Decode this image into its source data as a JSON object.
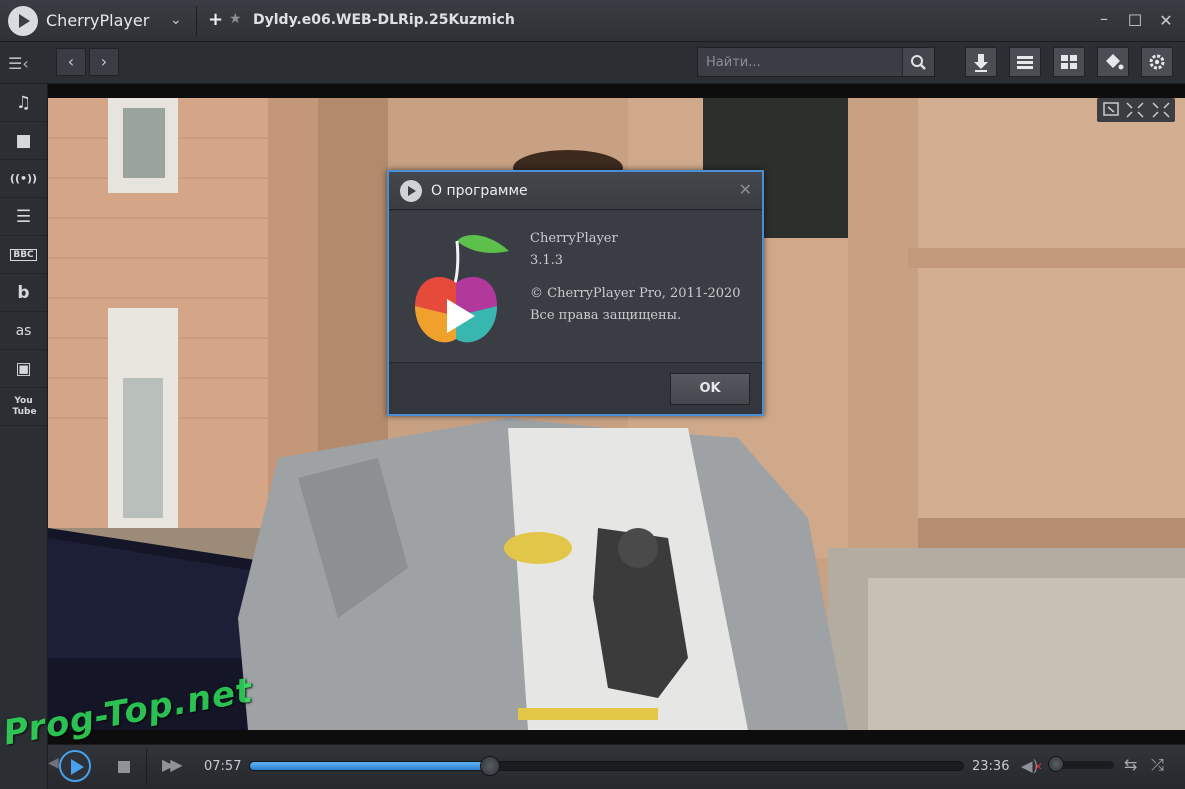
{
  "app": {
    "title": "CherryPlayer"
  },
  "tab": {
    "title": "Dyldy.e06.WEB-DLRip.25Kuzmich"
  },
  "search": {
    "placeholder": "Найти..."
  },
  "dialog": {
    "title": "О программе",
    "product": "CherryPlayer",
    "version": "3.1.3",
    "copyright": "© CherryPlayer Pro, 2011-2020",
    "rights": "Все права защищены.",
    "ok_label": "OK"
  },
  "sidebar": {
    "items": [
      {
        "name": "music",
        "icon": "music-note-icon",
        "glyph": "♫"
      },
      {
        "name": "video",
        "icon": "video-camera-icon",
        "glyph": "■"
      },
      {
        "name": "radio",
        "icon": "broadcast-icon",
        "glyph": "((•))"
      },
      {
        "name": "tv",
        "icon": "tv-guide-icon",
        "glyph": "☰"
      },
      {
        "name": "bbc",
        "icon": "bbc-icon",
        "glyph": "BBC"
      },
      {
        "name": "beatport",
        "icon": "beatport-icon",
        "glyph": "b"
      },
      {
        "name": "lastfm",
        "icon": "lastfm-icon",
        "glyph": "as"
      },
      {
        "name": "twitch",
        "icon": "twitch-icon",
        "glyph": "▣"
      },
      {
        "name": "youtube",
        "icon": "youtube-icon",
        "glyph": "You Tube"
      }
    ]
  },
  "player": {
    "elapsed": "07:57",
    "duration": "23:36",
    "progress_fraction": 0.337,
    "volume_fraction": 0.0,
    "muted": true
  },
  "watermark": "Prog-Top.net",
  "colors": {
    "accent": "#47a1ec",
    "dialog_border": "#4a8fd4",
    "watermark": "#2fe05a"
  }
}
